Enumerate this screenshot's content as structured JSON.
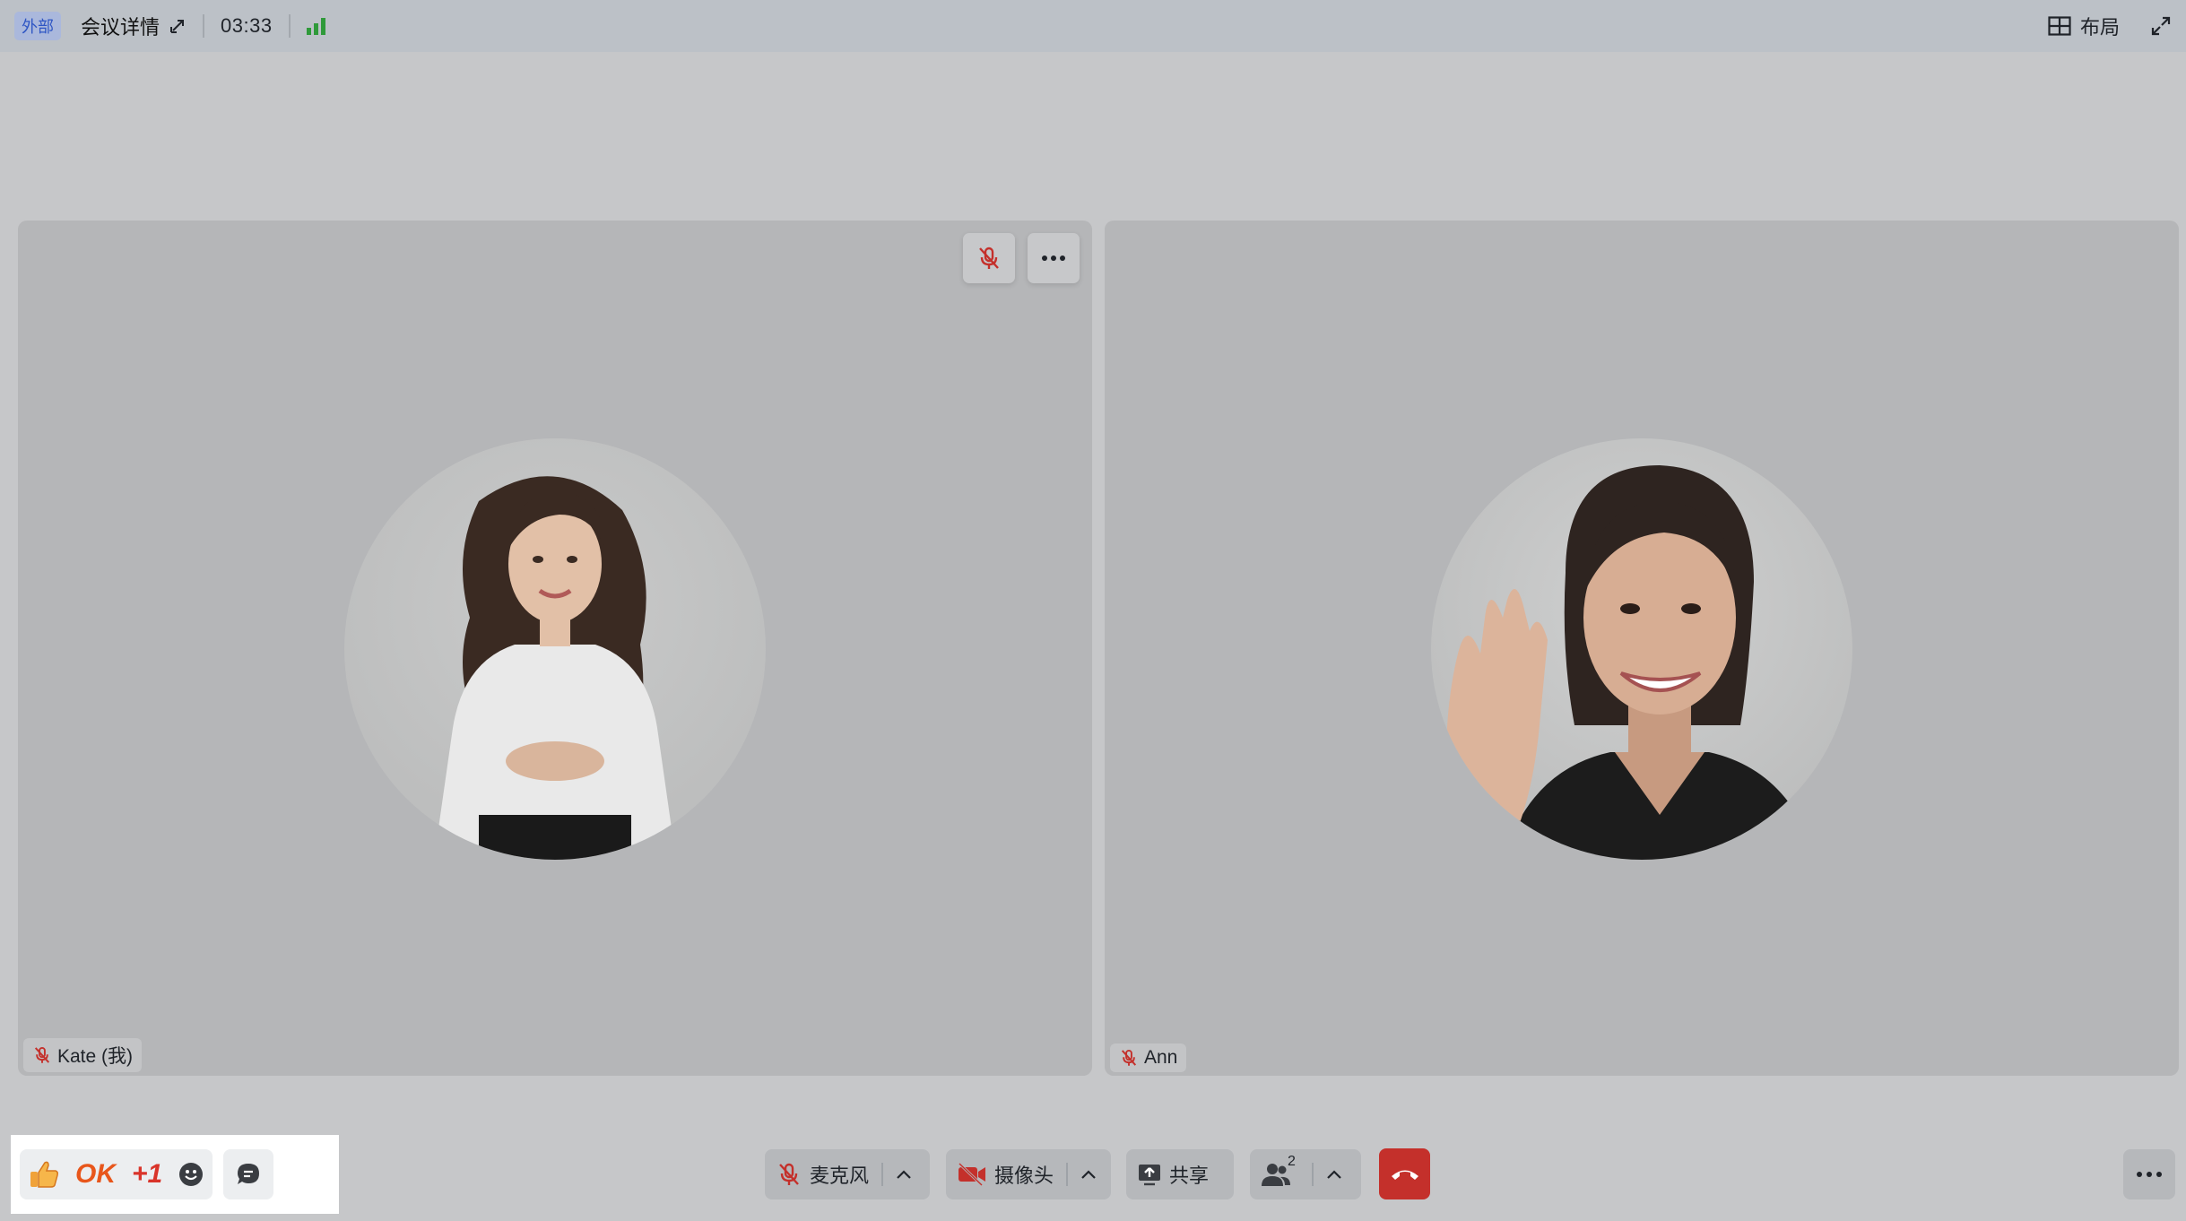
{
  "topbar": {
    "badge": "外部",
    "meeting_title": "会议详情",
    "timer": "03:33",
    "layout_label": "布局"
  },
  "participants": [
    {
      "name": "Kate (我)",
      "muted": true
    },
    {
      "name": "Ann",
      "muted": true
    }
  ],
  "reactions": {
    "ok": "OK",
    "plus_one": "+1"
  },
  "controls": {
    "mic_label": "麦克风",
    "camera_label": "摄像头",
    "share_label": "共享",
    "participants_count": "2"
  },
  "colors": {
    "accent_red": "#c4302b",
    "signal_green": "#2f9a3a",
    "badge_blue": "#2f56c4"
  }
}
